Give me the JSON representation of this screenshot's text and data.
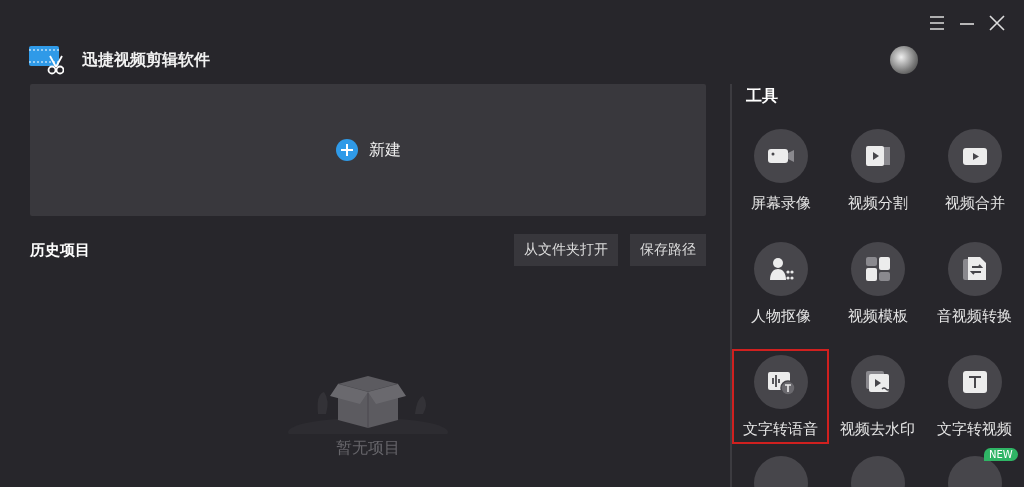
{
  "window": {
    "title": "迅捷视频剪辑软件"
  },
  "new_project": {
    "label": "新建"
  },
  "history": {
    "title": "历史项目",
    "buttons": [
      "从文件夹打开",
      "保存路径"
    ],
    "empty_text": "暂无项目"
  },
  "tools": {
    "title": "工具",
    "items": [
      {
        "label": "屏幕录像",
        "highlighted": false
      },
      {
        "label": "视频分割",
        "highlighted": false
      },
      {
        "label": "视频合并",
        "highlighted": false
      },
      {
        "label": "人物抠像",
        "highlighted": false
      },
      {
        "label": "视频模板",
        "highlighted": false
      },
      {
        "label": "音视频转换",
        "highlighted": false
      },
      {
        "label": "文字转语音",
        "highlighted": true
      },
      {
        "label": "视频去水印",
        "highlighted": false
      },
      {
        "label": "文字转视频",
        "highlighted": false
      }
    ],
    "partial_row": [
      {
        "kind": "plain"
      },
      {
        "kind": "plain"
      },
      {
        "kind": "new",
        "badge": "NEW"
      }
    ]
  }
}
